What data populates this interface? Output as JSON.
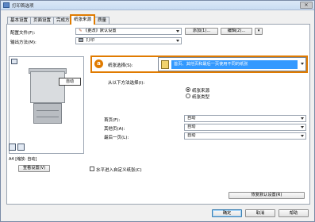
{
  "window": {
    "title": "打印首选项",
    "close_glyph": "✕"
  },
  "tabs": [
    {
      "label": "基本设置"
    },
    {
      "label": "页面设置"
    },
    {
      "label": "完成方式"
    },
    {
      "label": "纸张来源"
    },
    {
      "label": "质量"
    }
  ],
  "profile": {
    "label": "配置文件(F):",
    "value": "《更改》默认设置",
    "add_button": "添加(1)...",
    "edit_button": "编辑(2)...",
    "more_glyph": "▾"
  },
  "output": {
    "label": "输出方法(M):",
    "value": "打印"
  },
  "paper_selection": {
    "label": "纸张选择(S):",
    "value": "首页、其他页和最后一页使用不同的纸张",
    "badge": "a",
    "from_label": "从以下方法选择(I):",
    "radio_source": "纸张来源",
    "radio_type": "纸张类型"
  },
  "pages": {
    "first_label": "首页(F):",
    "first_value": "自动",
    "other_label": "其他页(A):",
    "other_value": "自动",
    "last_label": "最后一页(L):",
    "last_value": "自动"
  },
  "preview": {
    "auto_chip": "自动",
    "size_text": "A4 [缩放: 自动]",
    "view_button": "查看设置(V)"
  },
  "checkbox_label": "水平进入自定义纸张(C)",
  "restore_button": "恢复默认设置(R)",
  "dialog_buttons": {
    "ok": "确定",
    "cancel": "取消",
    "help": "帮助"
  }
}
